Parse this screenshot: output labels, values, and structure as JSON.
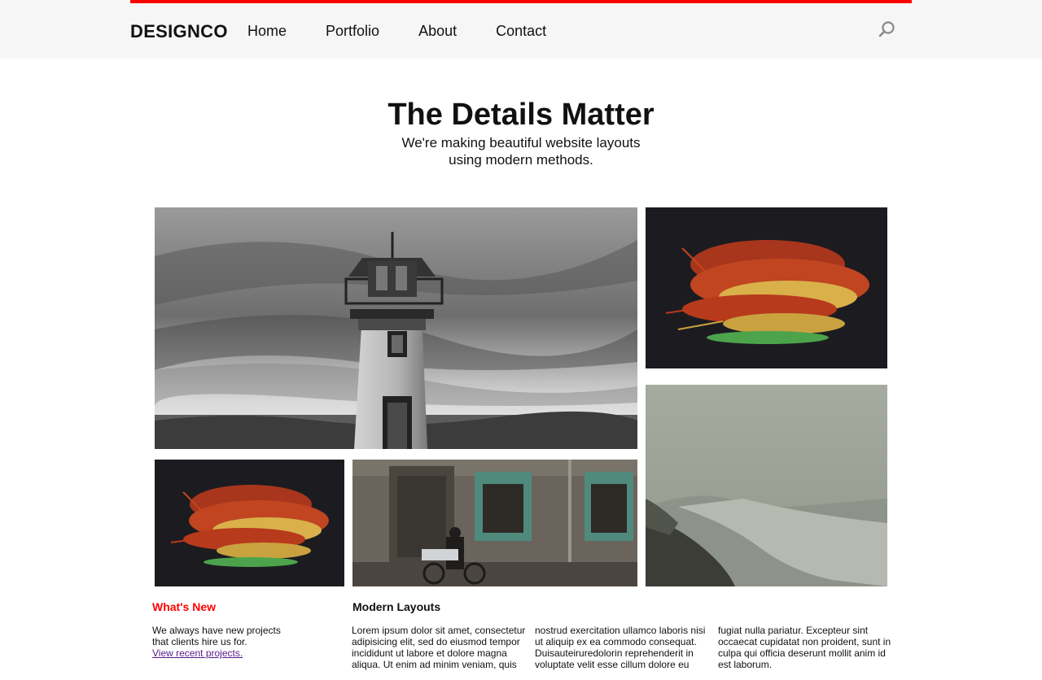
{
  "header": {
    "logo": "DESIGNCO",
    "nav": [
      "Home",
      "Portfolio",
      "About",
      "Contact"
    ],
    "accent_color": "#ff0000",
    "search_icon": "search-icon"
  },
  "hero": {
    "title": "The Details Matter",
    "subtitle": "We're making beautiful website layouts using modern methods."
  },
  "gallery": [
    {
      "name": "lighthouse-image",
      "subject": "black and white lighthouse under cloudy sky"
    },
    {
      "name": "flowers-image",
      "subject": "red and yellow dried flowers on dark background"
    },
    {
      "name": "foggy-beach-image",
      "subject": "foggy coastline beach"
    },
    {
      "name": "flowers-small-image",
      "subject": "red and yellow dried flowers on dark background"
    },
    {
      "name": "street-cyclist-image",
      "subject": "cyclist passing old building with green windows"
    }
  ],
  "sections": {
    "whats_new": {
      "heading": "What's New",
      "text": "We always have new projects that clients hire us for.",
      "link": "View recent projects."
    },
    "modern_layouts": {
      "heading": "Modern Layouts",
      "col1": "Lorem ipsum dolor sit amet, consectetur adipisicing elit, sed do eiusmod tempor incididunt ut labore et dolore magna aliqua. Ut enim ad minim veniam, quis",
      "col2": "nostrud exercitation ullamco laboris nisi ut aliquip ex ea commodo consequat. Duisauteiruredolorin reprehenderit in voluptate velit esse cillum dolore eu",
      "col3": "fugiat nulla pariatur. Excepteur sint occaecat cupidatat non proident, sunt in culpa qui officia deserunt mollit anim id est laborum."
    }
  }
}
